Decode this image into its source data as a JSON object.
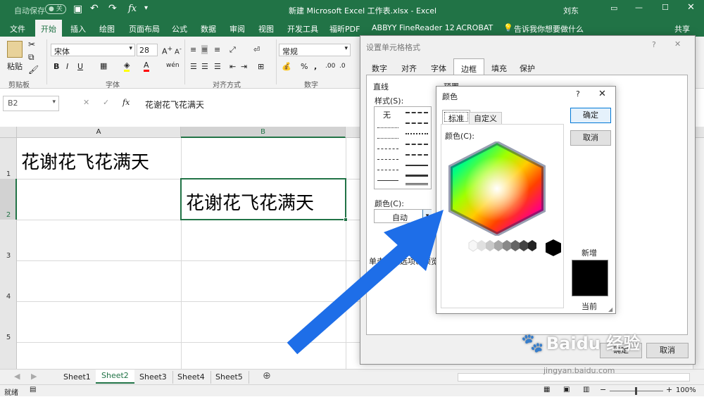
{
  "titlebar": {
    "autosave": "自动保存",
    "autosave_state": "关",
    "title": "新建 Microsoft Excel 工作表.xlsx - Excel",
    "user": "刘东"
  },
  "tabs": [
    "文件",
    "开始",
    "插入",
    "绘图",
    "页面布局",
    "公式",
    "数据",
    "审阅",
    "视图",
    "开发工具",
    "福昕PDF",
    "ABBYY FineReader 12",
    "ACROBAT"
  ],
  "tell_me": "告诉我你想要做什么",
  "share": "共享",
  "ribbon": {
    "paste": "粘贴",
    "font_name": "宋体",
    "font_size": "28",
    "number_format": "常规",
    "groups": [
      "剪贴板",
      "字体",
      "对齐方式",
      "数字"
    ]
  },
  "formula_bar": {
    "name_box": "B2",
    "content": "花谢花飞花满天"
  },
  "grid": {
    "columns": [
      "A",
      "B"
    ],
    "rows": [
      "1",
      "2",
      "3",
      "4",
      "5"
    ],
    "a1": "花谢花飞花满天",
    "b2": "花谢花飞花满天"
  },
  "sheets": [
    "Sheet1",
    "Sheet2",
    "Sheet3",
    "Sheet4",
    "Sheet5"
  ],
  "active_sheet": "Sheet2",
  "status": {
    "ready": "就绪",
    "zoom": "100%"
  },
  "format_dialog": {
    "title": "设置单元格格式",
    "tabs": [
      "数字",
      "对齐",
      "字体",
      "边框",
      "填充",
      "保护"
    ],
    "active_tab": "边框",
    "line_label": "直线",
    "style_label": "样式(S):",
    "none_label": "无",
    "preset_label": "预置",
    "color_label": "颜色(C):",
    "color_value": "自动",
    "hint": "单击预置选项、预览草",
    "ok": "确定",
    "cancel": "取消"
  },
  "color_dialog": {
    "title": "颜色",
    "tabs": [
      "标准",
      "自定义"
    ],
    "colors_label": "颜色(C):",
    "ok": "确定",
    "cancel": "取消",
    "new_label": "新增",
    "current_label": "当前",
    "new_color": "#000000"
  },
  "watermark": {
    "brand": "Baidu 经验",
    "url": "jingyan.baidu.com"
  },
  "annotation": {
    "arrow_color": "#1e6ee8"
  }
}
